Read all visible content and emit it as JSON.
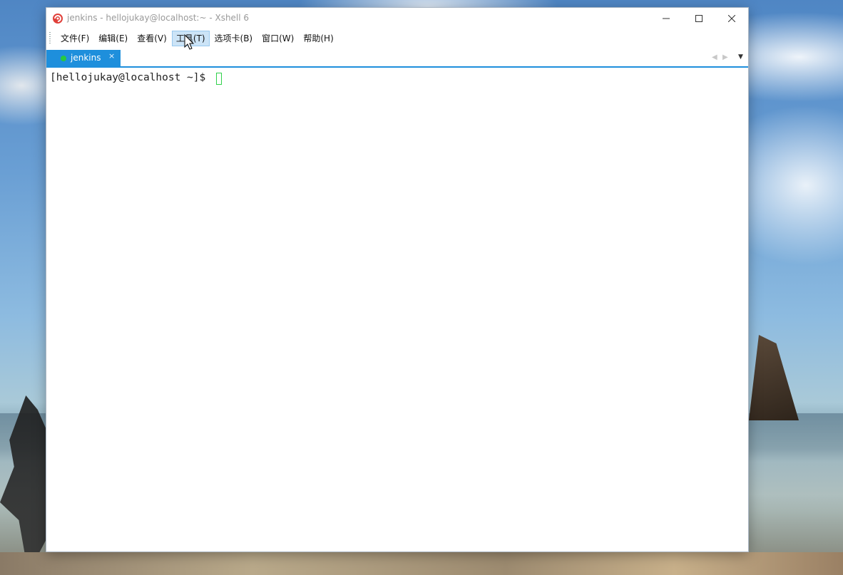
{
  "window": {
    "title": "jenkins - hellojukay@localhost:~ - Xshell 6",
    "controls": {
      "minimize": "minimize-icon",
      "maximize": "maximize-icon",
      "close": "close-icon"
    }
  },
  "menu": {
    "items": [
      {
        "label": "文件(F)"
      },
      {
        "label": "编辑(E)"
      },
      {
        "label": "查看(V)"
      },
      {
        "label": "工具(T)"
      },
      {
        "label": "选项卡(B)"
      },
      {
        "label": "窗口(W)"
      },
      {
        "label": "帮助(H)"
      }
    ],
    "active_index": 3
  },
  "tabs": [
    {
      "label": "jenkins",
      "status_color": "#27c93f",
      "close_glyph": "×"
    }
  ],
  "terminal": {
    "prompt": "[hellojukay@localhost ~]$ ",
    "cursor_color": "#2fd14a"
  },
  "colors": {
    "accent": "#1e8fdc",
    "menu_highlight": "#cce4f7"
  }
}
